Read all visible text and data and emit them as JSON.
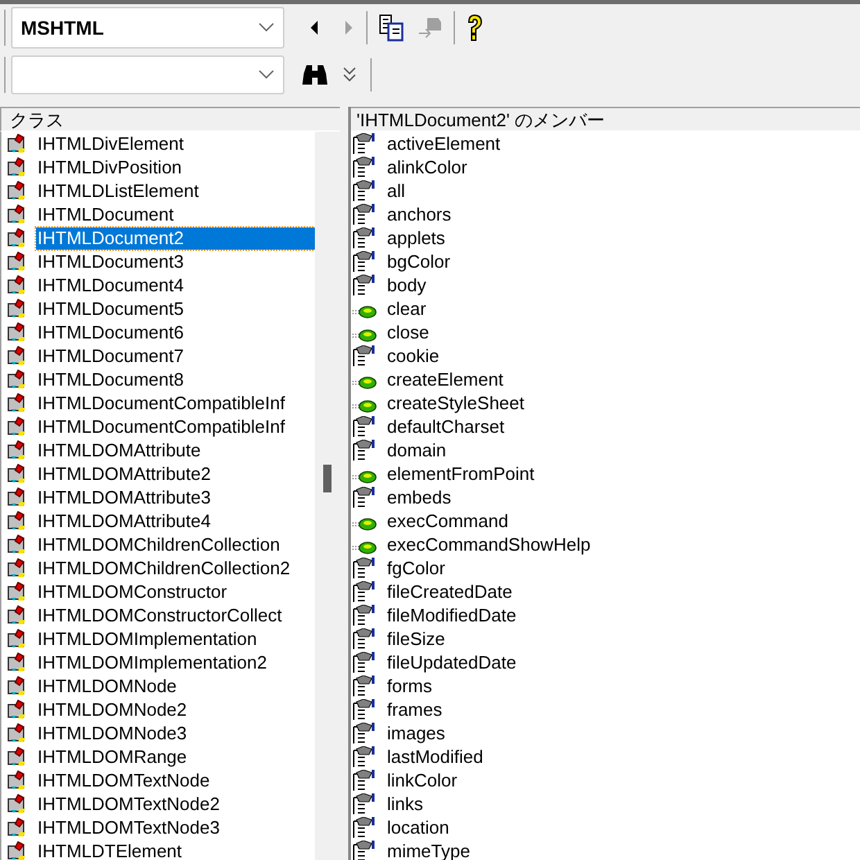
{
  "toolbar": {
    "library": {
      "value": "MSHTML"
    },
    "back": {
      "disabled": false
    },
    "forward": {
      "disabled": true
    },
    "copy": {
      "disabled": false
    },
    "view_definition": {
      "disabled": true
    }
  },
  "classes": {
    "header": "クラス",
    "items": [
      {
        "label": "IHTMLDivElement",
        "selected": false
      },
      {
        "label": "IHTMLDivPosition",
        "selected": false
      },
      {
        "label": "IHTMLDListElement",
        "selected": false
      },
      {
        "label": "IHTMLDocument",
        "selected": false
      },
      {
        "label": "IHTMLDocument2",
        "selected": true
      },
      {
        "label": "IHTMLDocument3",
        "selected": false
      },
      {
        "label": "IHTMLDocument4",
        "selected": false
      },
      {
        "label": "IHTMLDocument5",
        "selected": false
      },
      {
        "label": "IHTMLDocument6",
        "selected": false
      },
      {
        "label": "IHTMLDocument7",
        "selected": false
      },
      {
        "label": "IHTMLDocument8",
        "selected": false
      },
      {
        "label": "IHTMLDocumentCompatibleInf",
        "selected": false
      },
      {
        "label": "IHTMLDocumentCompatibleInf",
        "selected": false
      },
      {
        "label": "IHTMLDOMAttribute",
        "selected": false
      },
      {
        "label": "IHTMLDOMAttribute2",
        "selected": false
      },
      {
        "label": "IHTMLDOMAttribute3",
        "selected": false
      },
      {
        "label": "IHTMLDOMAttribute4",
        "selected": false
      },
      {
        "label": "IHTMLDOMChildrenCollection",
        "selected": false
      },
      {
        "label": "IHTMLDOMChildrenCollection2",
        "selected": false
      },
      {
        "label": "IHTMLDOMConstructor",
        "selected": false
      },
      {
        "label": "IHTMLDOMConstructorCollect",
        "selected": false
      },
      {
        "label": "IHTMLDOMImplementation",
        "selected": false
      },
      {
        "label": "IHTMLDOMImplementation2",
        "selected": false
      },
      {
        "label": "IHTMLDOMNode",
        "selected": false
      },
      {
        "label": "IHTMLDOMNode2",
        "selected": false
      },
      {
        "label": "IHTMLDOMNode3",
        "selected": false
      },
      {
        "label": "IHTMLDOMRange",
        "selected": false
      },
      {
        "label": "IHTMLDOMTextNode",
        "selected": false
      },
      {
        "label": "IHTMLDOMTextNode2",
        "selected": false
      },
      {
        "label": "IHTMLDOMTextNode3",
        "selected": false
      },
      {
        "label": "IHTMLDTElement",
        "selected": false
      }
    ]
  },
  "members": {
    "header": "'IHTMLDocument2' のメンバー",
    "items": [
      {
        "label": "activeElement",
        "kind": "property"
      },
      {
        "label": "alinkColor",
        "kind": "property"
      },
      {
        "label": "all",
        "kind": "property"
      },
      {
        "label": "anchors",
        "kind": "property"
      },
      {
        "label": "applets",
        "kind": "property"
      },
      {
        "label": "bgColor",
        "kind": "property"
      },
      {
        "label": "body",
        "kind": "property"
      },
      {
        "label": "clear",
        "kind": "method"
      },
      {
        "label": "close",
        "kind": "method"
      },
      {
        "label": "cookie",
        "kind": "property"
      },
      {
        "label": "createElement",
        "kind": "method"
      },
      {
        "label": "createStyleSheet",
        "kind": "method"
      },
      {
        "label": "defaultCharset",
        "kind": "property"
      },
      {
        "label": "domain",
        "kind": "property"
      },
      {
        "label": "elementFromPoint",
        "kind": "method"
      },
      {
        "label": "embeds",
        "kind": "property"
      },
      {
        "label": "execCommand",
        "kind": "method"
      },
      {
        "label": "execCommandShowHelp",
        "kind": "method"
      },
      {
        "label": "fgColor",
        "kind": "property"
      },
      {
        "label": "fileCreatedDate",
        "kind": "property"
      },
      {
        "label": "fileModifiedDate",
        "kind": "property"
      },
      {
        "label": "fileSize",
        "kind": "property"
      },
      {
        "label": "fileUpdatedDate",
        "kind": "property"
      },
      {
        "label": "forms",
        "kind": "property"
      },
      {
        "label": "frames",
        "kind": "property"
      },
      {
        "label": "images",
        "kind": "property"
      },
      {
        "label": "lastModified",
        "kind": "property"
      },
      {
        "label": "linkColor",
        "kind": "property"
      },
      {
        "label": "links",
        "kind": "property"
      },
      {
        "label": "location",
        "kind": "property"
      },
      {
        "label": "mimeType",
        "kind": "property"
      }
    ]
  }
}
